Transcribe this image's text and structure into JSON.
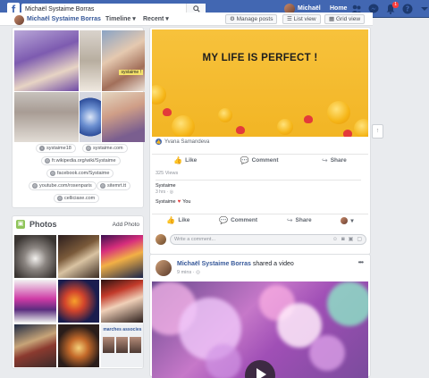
{
  "topbar": {
    "search_value": "Michaël Systaime Borras",
    "user_name": "Michaël",
    "home_label": "Home",
    "notifications_count": "1"
  },
  "subnav": {
    "profile_name": "Michaël Systaime Borras",
    "timeline_label": "Timeline",
    "recent_label": "Recent",
    "manage_posts_label": "Manage posts",
    "list_view_label": "List view",
    "grid_view_label": "Grid view"
  },
  "intro": {
    "photo_label": "systaime !",
    "links": [
      {
        "label": "systaime18",
        "icon": "twitter-icon"
      },
      {
        "label": "systaime.com",
        "icon": "globe-icon"
      },
      {
        "label": "fr.wikipedia.org/wiki/Systaime",
        "icon": "globe-icon"
      },
      {
        "label": "facebook.com/Systaime",
        "icon": "globe-icon"
      },
      {
        "label": "youtube.com/rosenparis",
        "icon": "globe-icon"
      },
      {
        "label": "sitemrt.tt",
        "icon": "globe-icon"
      },
      {
        "label": "celliciaxe.com",
        "icon": "globe-icon"
      }
    ]
  },
  "photos": {
    "title": "Photos",
    "add_label": "Add Photo",
    "tile9_title": "marches associes"
  },
  "post1": {
    "headline": "MY LIFE IS PERFECT !",
    "reaction_name": "Yvana Samandeva",
    "like_label": "Like",
    "comment_label": "Comment",
    "share_label": "Share",
    "views": "325 Views",
    "share_name": "Systaime",
    "share_time": "3 hrs",
    "share_reaction": "Systaime",
    "share_reaction_suffix": "You",
    "comment_placeholder": "Write a comment..."
  },
  "post2": {
    "author": "Michaël Systaime Borras",
    "suffix": "shared a video",
    "time": "9 mins"
  },
  "colors": {
    "facebook_blue": "#4267b2",
    "link_blue": "#365899",
    "post_yellow": "#f7c23c"
  }
}
